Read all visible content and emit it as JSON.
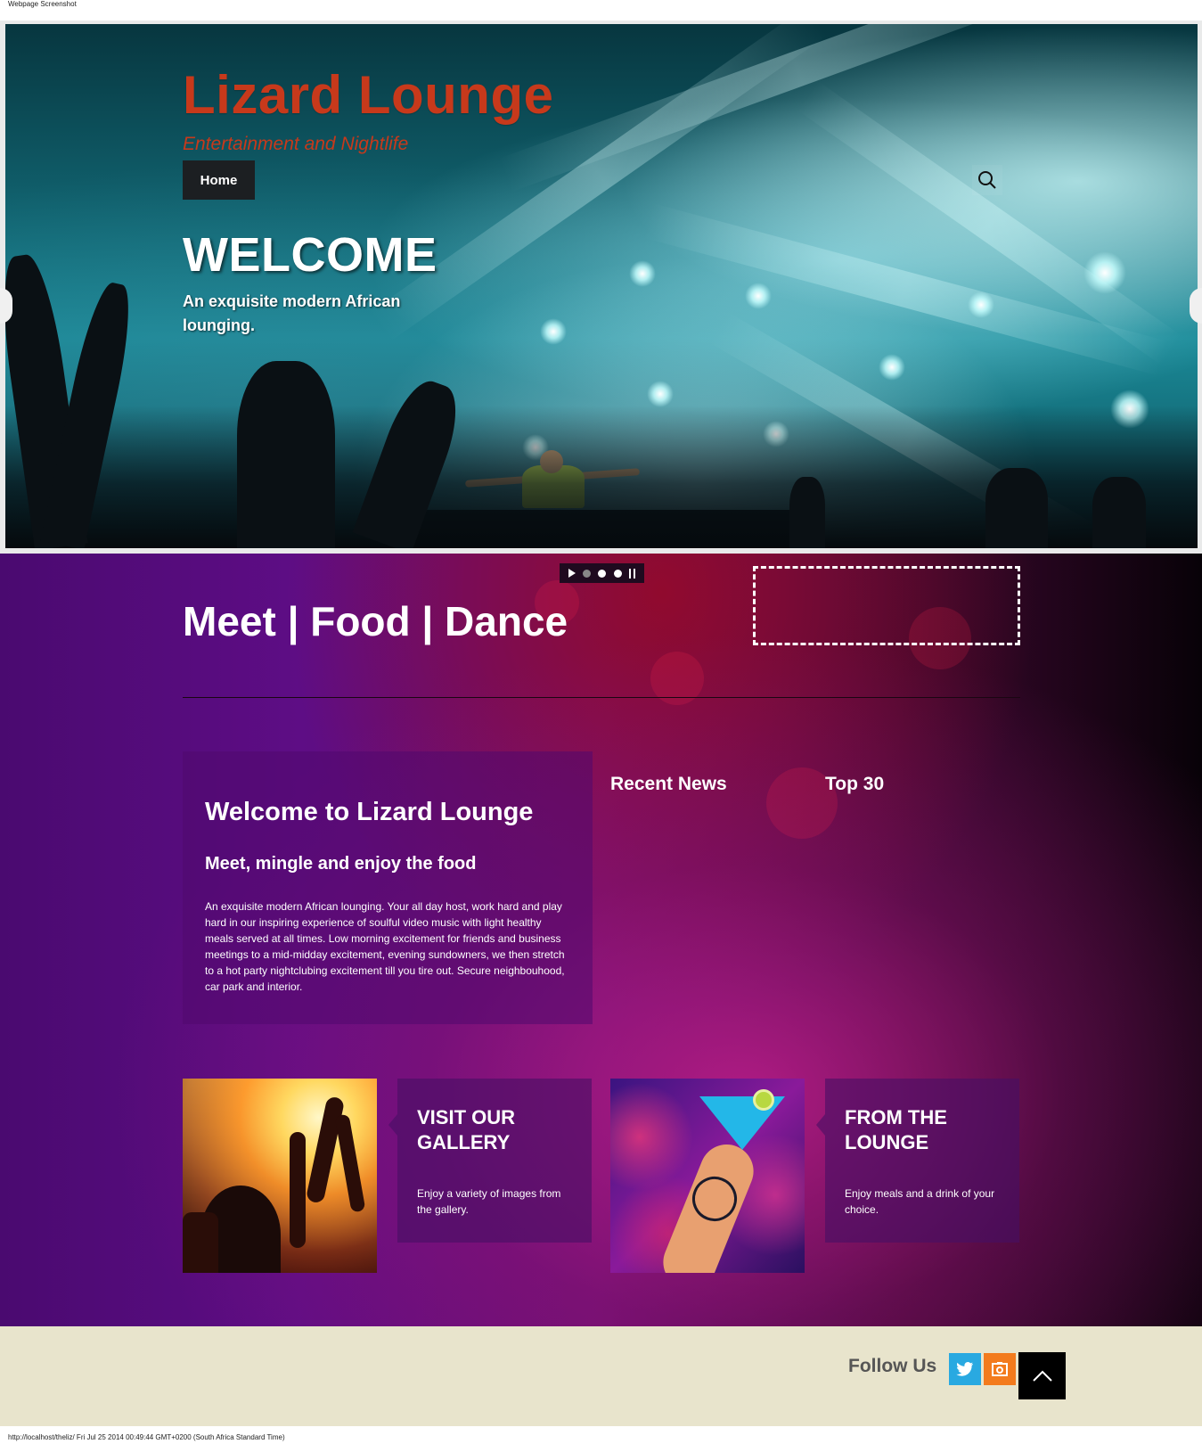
{
  "capture": {
    "label": "Webpage Screenshot",
    "footer": "http://localhost/theliz/ Fri Jul 25 2014 00:49:44 GMT+0200 (South Africa Standard Time)"
  },
  "header": {
    "site_title": "Lizard Lounge",
    "tagline": "Entertainment and Nightlife",
    "nav": [
      {
        "label": "Home"
      }
    ],
    "search_icon": "search-icon"
  },
  "hero": {
    "heading": "WELCOME",
    "subheading": "An exquisite modern African lounging."
  },
  "slider": {
    "controls": [
      "play-icon",
      "dot",
      "dot",
      "dot",
      "pause-icon"
    ]
  },
  "intro": {
    "tagline": "Meet | Food | Dance"
  },
  "welcome": {
    "title": "Welcome to Lizard Lounge",
    "subtitle": "Meet, mingle and enjoy the food",
    "body": "An exquisite modern African lounging. Your all day host, work hard and play hard in our inspiring experience of soulful video music with light healthy meals served at all times. Low morning excitement for friends and business meetings to a mid-midday excitement, evening sundowners, we then stretch to a hot party nightclubing excitement till you tire out. Secure neighbouhood, car park and interior."
  },
  "widgets": {
    "recent_news": "Recent News",
    "top30": "Top 30"
  },
  "features": [
    {
      "title": "VISIT OUR GALLERY",
      "text": "Enjoy a variety of images from the gallery."
    },
    {
      "title": "FROM THE LOUNGE",
      "text": "Enjoy meals and a drink of your choice."
    }
  ],
  "footer": {
    "follow_label": "Follow Us",
    "social": [
      {
        "icon": "twitter-icon"
      },
      {
        "icon": "rss-icon"
      }
    ],
    "back_to_top_icon": "chevron-up-icon"
  },
  "colors": {
    "brand": "#c7391b",
    "nav_bg": "#1c1f22",
    "footer_bg": "#e8e4cc",
    "twitter": "#29a9e1",
    "rss": "#f37b1d"
  }
}
